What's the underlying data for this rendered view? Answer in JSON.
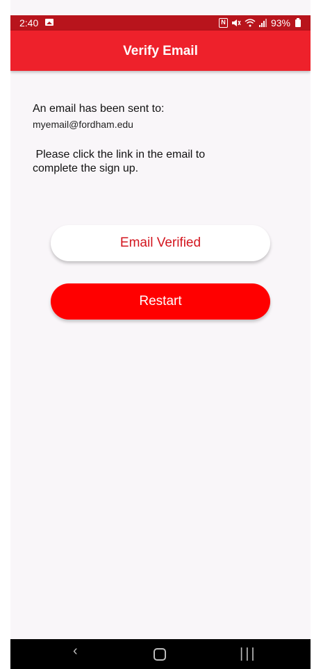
{
  "status_bar": {
    "time": "2:40",
    "battery": "93%",
    "nfc_label": "N"
  },
  "app_bar": {
    "title": "Verify Email"
  },
  "content": {
    "sent_label": "An email has been sent to:",
    "email": "myemail@fordham.edu",
    "instructions": " Please click the link in the email to\ncomplete the sign up."
  },
  "buttons": {
    "email_verified": "Email Verified",
    "restart": "Restart"
  },
  "nav": {
    "back": "‹",
    "recents": "|||"
  },
  "colors": {
    "status_bar": "#b8141c",
    "app_bar": "#ee212b",
    "restart_button": "#ff0000",
    "verified_text": "#d3161f",
    "background": "#f9f6f9"
  }
}
